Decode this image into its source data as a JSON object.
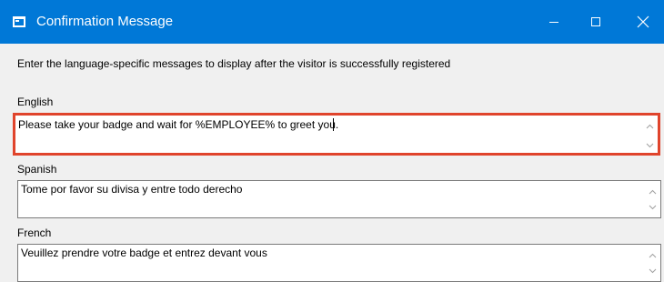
{
  "window": {
    "title": "Confirmation Message",
    "title_bg": "#0078d7",
    "icons": {
      "app": "window-app-icon",
      "minimize": "minimize-icon",
      "maximize": "maximize-icon",
      "close": "close-icon"
    }
  },
  "instruction": "Enter the language-specific messages to display after the visitor is successfully registered",
  "fields": [
    {
      "label": "English",
      "value": "Please take your badge and wait for %EMPLOYEE% to greet you.",
      "focused": true
    },
    {
      "label": "Spanish",
      "value": "Tome por favor su divisa y entre todo derecho",
      "focused": false
    },
    {
      "label": "French",
      "value": "Veuillez prendre votre badge et entrez devant vous",
      "focused": false
    }
  ],
  "colors": {
    "focus_highlight": "#e0442c"
  }
}
